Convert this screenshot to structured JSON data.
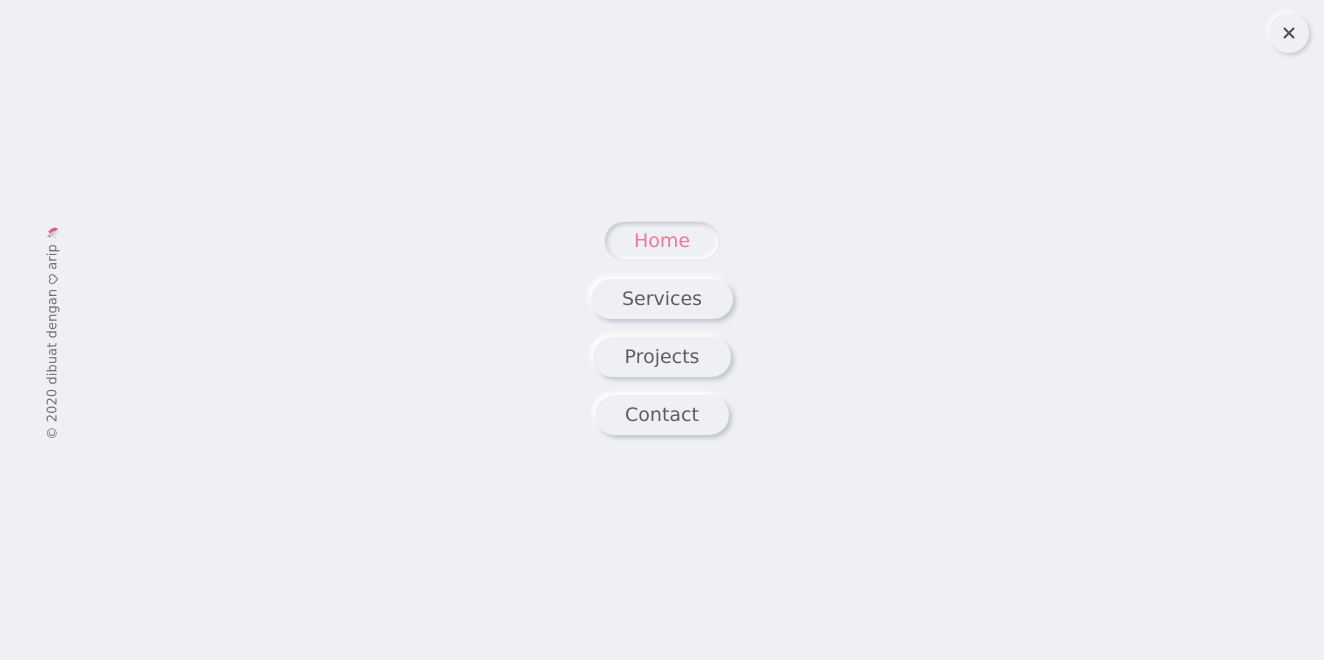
{
  "menu": {
    "items": [
      {
        "label": "Home",
        "active": true
      },
      {
        "label": "Services",
        "active": false
      },
      {
        "label": "Projects",
        "active": false
      },
      {
        "label": "Contact",
        "active": false
      }
    ]
  },
  "close_icon": "close-icon",
  "credit": {
    "prefix": "© 2020 dibuat dengan",
    "heart_icon": "heart-icon",
    "author": "arip",
    "emoji": "🦄"
  },
  "colors": {
    "background": "#eff0f4",
    "text": "#5b5d61",
    "accent": "#f07795"
  }
}
